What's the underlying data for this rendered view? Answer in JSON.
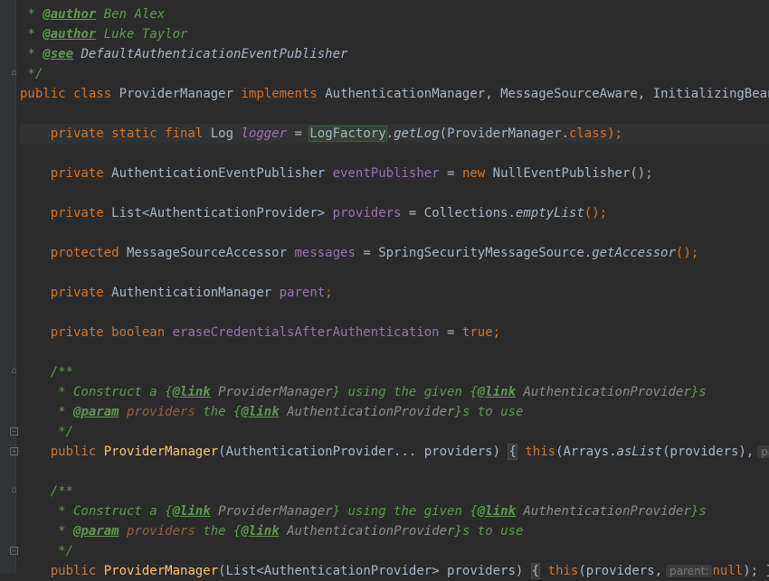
{
  "lines": {
    "l1": {
      "star": " * ",
      "tag": "@author",
      "text": " Ben Alex"
    },
    "l2": {
      "star": " * ",
      "tag": "@author",
      "text": " Luke Taylor"
    },
    "l3": {
      "star": " * ",
      "tag": "@see",
      "text": " DefaultAuthenticationEventPublisher"
    },
    "l4": {
      "text": " */"
    },
    "l5": {
      "public": "public",
      "class": "class",
      "name": "ProviderManager",
      "implements": "implements",
      "ifaces": "AuthenticationManager, MessageSourceAware, InitializingBean {"
    },
    "l7": {
      "mods": "private static final",
      "type": "Log",
      "field": "logger",
      "eq": " = ",
      "factory": "LogFactory",
      "dot": ".",
      "call": "getLog",
      "args": "(ProviderManager.",
      "classkw": "class",
      "end": ");"
    },
    "l9": {
      "mods": "private",
      "type": "AuthenticationEventPublisher",
      "field": "eventPublisher",
      "eq": " = ",
      "new": "new",
      "rest": " NullEventPublisher();"
    },
    "l11": {
      "mods": "private",
      "type": "List<AuthenticationProvider>",
      "field": "providers",
      "eq": " = Collections.",
      "call": "emptyList",
      "end": "();"
    },
    "l13": {
      "mods": "protected",
      "type": "MessageSourceAccessor",
      "field": "messages",
      "eq": " = SpringSecurityMessageSource.",
      "call": "getAccessor",
      "end": "();"
    },
    "l15": {
      "mods": "private",
      "type": "AuthenticationManager",
      "field": "parent",
      "end": ";"
    },
    "l17": {
      "mods": "private boolean",
      "field": "eraseCredentialsAfterAuthentication",
      "eq": " = ",
      "val": "true",
      "end": ";"
    },
    "l19": {
      "text": "/**"
    },
    "l20": {
      "pre": " * Construct a ",
      "ob": "{",
      "link": "@link",
      "ref": " ProviderManager",
      "cb": "}",
      "mid": " using the given ",
      "ob2": "{",
      "link2": "@link",
      "ref2": " AuthenticationProvider",
      "cb2": "}",
      "post": "s"
    },
    "l21": {
      "pre": " * ",
      "tag": "@param",
      "param": " providers",
      "mid": " the ",
      "ob": "{",
      "link": "@link",
      "ref": " AuthenticationProvider",
      "cb": "}",
      "post": "s to use"
    },
    "l22": {
      "text": " */"
    },
    "l23": {
      "public": "public",
      "name": "ProviderManager",
      "args": "(AuthenticationProvider... providers)",
      "brace": "{",
      "this": "this",
      "rest1": "(Arrays.",
      "call": "asList",
      "rest2": "(providers),",
      "hint": "parent:"
    },
    "l25": {
      "text": "/**"
    },
    "l26": {
      "pre": " * Construct a ",
      "ob": "{",
      "link": "@link",
      "ref": " ProviderManager",
      "cb": "}",
      "mid": " using the given ",
      "ob2": "{",
      "link2": "@link",
      "ref2": " AuthenticationProvider",
      "cb2": "}",
      "post": "s"
    },
    "l27": {
      "pre": " * ",
      "tag": "@param",
      "param": " providers",
      "mid": " the ",
      "ob": "{",
      "link": "@link",
      "ref": " AuthenticationProvider",
      "cb": "}",
      "post": "s to use"
    },
    "l28": {
      "text": " */"
    },
    "l29": {
      "public": "public",
      "name": "ProviderManager",
      "args": "(List<AuthenticationProvider> providers)",
      "brace": "{",
      "this": "this",
      "rest1": "(providers,",
      "hint": "parent:",
      "null": "null",
      "end": "); }"
    }
  },
  "colors": {
    "background": "#2b2b2b",
    "keyword": "#cc7832",
    "field": "#9876aa",
    "method": "#ffc66d",
    "doc": "#629755"
  }
}
